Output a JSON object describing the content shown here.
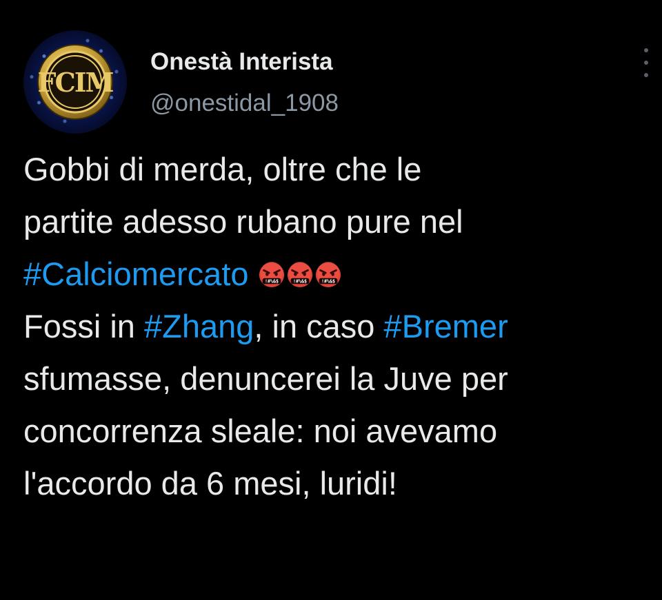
{
  "author": {
    "display_name": "Onestà Interista",
    "handle": "@onestidal_1908",
    "avatar_icon": "inter-logo-icon",
    "avatar_logo_text": "FCIM"
  },
  "tweet": {
    "line1": "Gobbi di merda, oltre che le",
    "line2": "partite adesso rubano pure nel",
    "hashtag_calciomercato": "#Calciomercato",
    "emojis": [
      "face-with-symbols-on-mouth-icon",
      "face-with-symbols-on-mouth-icon",
      "face-with-symbols-on-mouth-icon"
    ],
    "line4_before": "Fossi in ",
    "hashtag_zhang": "#Zhang",
    "line4_middle": ", in caso ",
    "hashtag_bremer": "#Bremer",
    "line5": "sfumasse, denuncerei la Juve per",
    "line6": "concorrenza sleale: noi avevamo",
    "line7": "l'accordo da 6 mesi, luridi!"
  },
  "colors": {
    "background": "#000000",
    "text": "#e7e9ea",
    "handle": "#8b98a5",
    "hashtag": "#1d9bf0",
    "avatar_gold": "#c9a33a"
  },
  "icons": {
    "more": "more-vertical-icon"
  }
}
